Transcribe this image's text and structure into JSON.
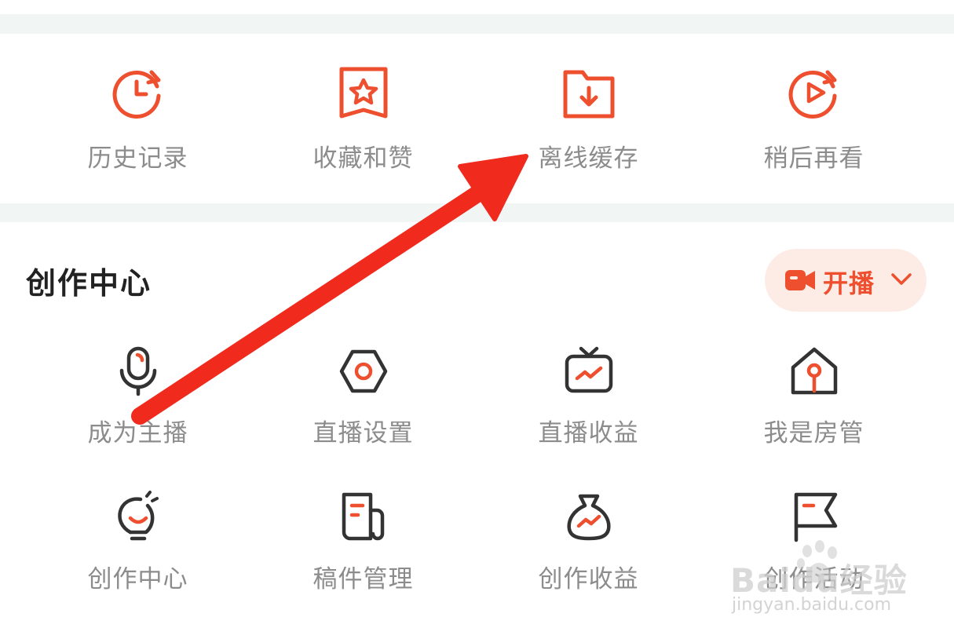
{
  "quick_actions": [
    {
      "label": "历史记录",
      "icon": "history-clock-icon"
    },
    {
      "label": "收藏和赞",
      "icon": "favorite-star-icon"
    },
    {
      "label": "离线缓存",
      "icon": "offline-download-folder-icon"
    },
    {
      "label": "稍后再看",
      "icon": "watch-later-play-icon"
    }
  ],
  "creator_section": {
    "title": "创作中心",
    "live_button": {
      "label": "开播",
      "icon": "video-camera-icon",
      "chevron": "chevron-down-icon"
    },
    "row1": [
      {
        "label": "成为主播",
        "icon": "microphone-icon"
      },
      {
        "label": "直播设置",
        "icon": "live-settings-hexagon-icon"
      },
      {
        "label": "直播收益",
        "icon": "tv-earnings-icon"
      },
      {
        "label": "我是房管",
        "icon": "room-manager-house-icon"
      }
    ],
    "row2": [
      {
        "label": "创作中心",
        "icon": "lightbulb-icon"
      },
      {
        "label": "稿件管理",
        "icon": "manuscript-document-icon"
      },
      {
        "label": "创作收益",
        "icon": "money-bag-icon"
      },
      {
        "label": "创作活动",
        "icon": "activity-flag-icon"
      }
    ]
  },
  "annotation": {
    "type": "red-arrow",
    "target": "离线缓存"
  },
  "watermark": {
    "brand": "Baidu经验",
    "url": "jingyan.baidu.com"
  },
  "colors": {
    "accent": "#ee4f2e",
    "dark_icon": "#333333",
    "label_gray": "#8c8c8c",
    "band_bg": "#f1f5f4",
    "live_btn_bg": "#fdece6",
    "arrow_red": "#f02a1d"
  }
}
